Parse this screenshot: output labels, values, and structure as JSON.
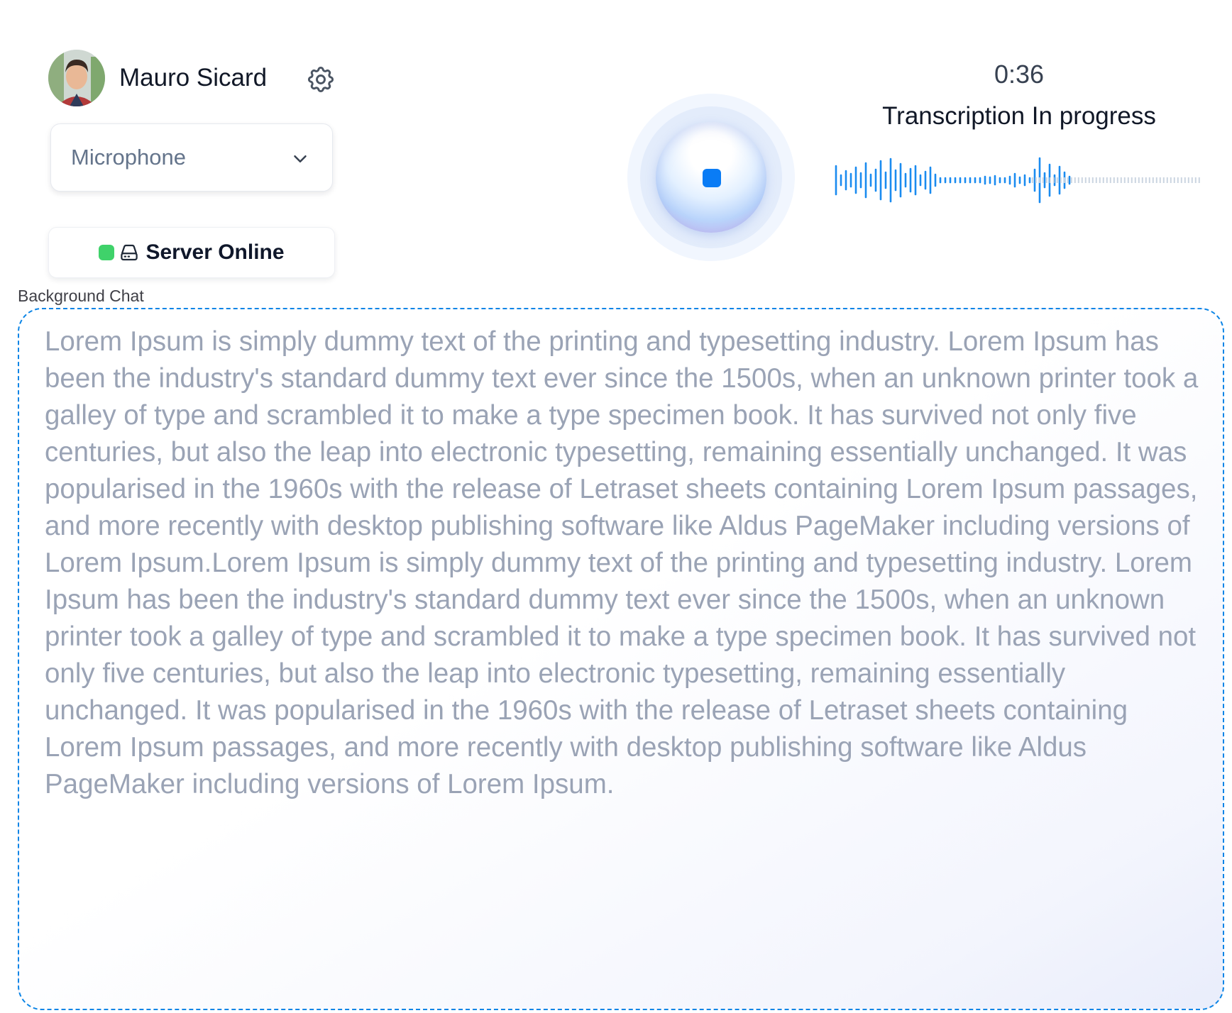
{
  "user": {
    "name": "Mauro Sicard",
    "avatar_icon": "user-avatar-photo",
    "settings_icon": "gear-icon"
  },
  "input_source": {
    "selected": "Microphone",
    "icon": "chevron-down-icon"
  },
  "server": {
    "status_label": "Server Online",
    "status_color": "#3fd26a",
    "icon": "server-icon"
  },
  "recorder": {
    "timer": "0:36",
    "status": "Transcription In progress",
    "accent_color": "#0a7cf5",
    "stop_icon": "stop-icon"
  },
  "chat": {
    "label": "Background Chat",
    "text": "Lorem Ipsum is simply dummy text of the printing and typesetting industry. Lorem Ipsum has been the industry's standard dummy text ever since the 1500s, when an unknown printer took a galley of type and scrambled it to make a type specimen book. It has survived not only five centuries, but also the leap into electronic typesetting, remaining essentially unchanged. It was popularised in the 1960s with the release of Letraset sheets containing Lorem Ipsum passages, and more recently with desktop publishing software like Aldus PageMaker including versions of Lorem Ipsum.Lorem Ipsum is simply dummy text of the printing and typesetting industry. Lorem Ipsum has been the industry's standard dummy text ever since the 1500s, when an unknown printer took a galley of type and scrambled it to make a type specimen book. It has survived not only five centuries, but also the leap into electronic typesetting, remaining essentially unchanged. It was popularised in the 1960s with the release of Letraset sheets containing Lorem Ipsum passages, and more recently with desktop publishing software like Aldus PageMaker including versions of Lorem Ipsum."
  }
}
